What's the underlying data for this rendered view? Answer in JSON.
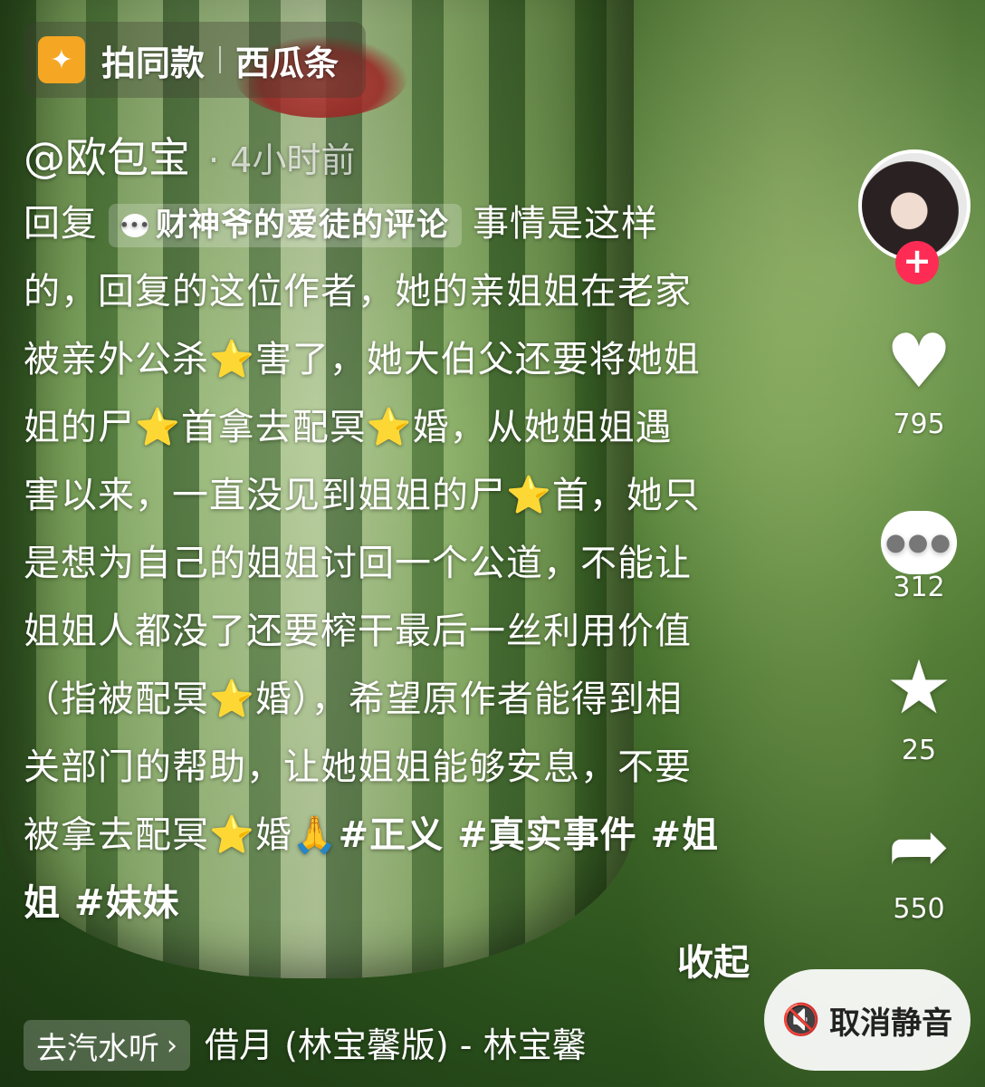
{
  "top_tag": {
    "icon": "sparkle-icon",
    "label_1": "拍同款",
    "label_2": "西瓜条"
  },
  "author": {
    "handle": "@欧包宝",
    "time": "· 4小时前"
  },
  "caption": {
    "reply_prefix": "回复",
    "reply_chip": "财神爷的爱徒的评论",
    "lines": [
      "事情是这样",
      "的，回复的这位作者，她的亲姐姐在老家",
      "被亲外公杀",
      "害了，她大伯父还要将她姐",
      "姐的尸",
      "首拿去配冥",
      "婚，从她姐姐遇",
      "害以来，一直没见到姐姐的尸",
      "首，她只",
      "是想为自己的姐姐讨回一个公道，不能让",
      "姐姐人都没了还要榨干最后一丝利用价值",
      "（指被配冥",
      "婚），希望原作者能得到相",
      "关部门的帮助，让她姐姐能够安息，不要",
      "被拿去配冥",
      "婚",
      "#正义 #真实事件 #姐",
      "姐 #妹妹"
    ],
    "star_glyph": "⭐",
    "pray_glyph": "🙏",
    "collapse_label": "收起"
  },
  "sidebar": {
    "avatar_icon": "avatar",
    "follow_label": "+",
    "like": {
      "icon": "heart-icon",
      "count": "795"
    },
    "comment": {
      "icon": "comment-icon",
      "count": "312"
    },
    "favorite": {
      "icon": "star-icon",
      "count": "25"
    },
    "share": {
      "icon": "share-icon",
      "count": "550"
    }
  },
  "mute_button": {
    "icon": "muted-speaker-icon",
    "label": "取消静音"
  },
  "music": {
    "button_label": "去汽水听",
    "title": "借月 (林宝馨版) - 林宝馨"
  },
  "colors": {
    "follow_red": "#fe2c55",
    "tag_orange": "#f5a623",
    "star_yellow": "#ffcc1a"
  }
}
